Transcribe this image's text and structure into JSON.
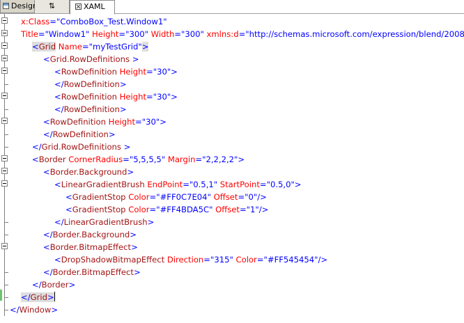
{
  "tabs": {
    "design": "Design",
    "swap": "⇅",
    "xaml": "XAML"
  },
  "lines": [
    {
      "indent": 30,
      "tokens": [
        {
          "t": "x:Class",
          "c": "a"
        },
        {
          "t": "=\"",
          "c": "b"
        },
        {
          "t": "ComboBox_Test.Window1",
          "c": "v"
        },
        {
          "t": "\"",
          "c": "b"
        }
      ]
    },
    {
      "indent": 30,
      "tokens": [
        {
          "t": "Title",
          "c": "a"
        },
        {
          "t": "=\"",
          "c": "b"
        },
        {
          "t": "Window1",
          "c": "v"
        },
        {
          "t": "\" ",
          "c": "b"
        },
        {
          "t": "Height",
          "c": "a"
        },
        {
          "t": "=\"",
          "c": "b"
        },
        {
          "t": "300",
          "c": "v"
        },
        {
          "t": "\" ",
          "c": "b"
        },
        {
          "t": "Width",
          "c": "a"
        },
        {
          "t": "=\"",
          "c": "b"
        },
        {
          "t": "300",
          "c": "v"
        },
        {
          "t": "\" ",
          "c": "b"
        },
        {
          "t": "xmlns:d",
          "c": "a"
        },
        {
          "t": "=\"",
          "c": "b"
        },
        {
          "t": "http://schemas.microsoft.com/expression/blend/2008",
          "c": "v"
        },
        {
          "t": "\"",
          "c": "b"
        }
      ]
    },
    {
      "indent": 46,
      "tokens": [
        {
          "t": "<",
          "c": "b",
          "hl": true
        },
        {
          "t": "Grid",
          "c": "e",
          "hl": true
        },
        {
          "t": " ",
          "c": "b"
        },
        {
          "t": "Name",
          "c": "a"
        },
        {
          "t": "=\"",
          "c": "b"
        },
        {
          "t": "myTestGrid",
          "c": "v"
        },
        {
          "t": "\"",
          "c": "b"
        },
        {
          "t": ">",
          "c": "b",
          "hl": true
        }
      ]
    },
    {
      "indent": 62,
      "tokens": [
        {
          "t": "<",
          "c": "b"
        },
        {
          "t": "Grid.RowDefinitions",
          "c": "e"
        },
        {
          "t": " >",
          "c": "b"
        }
      ]
    },
    {
      "indent": 78,
      "tokens": [
        {
          "t": "<",
          "c": "b"
        },
        {
          "t": "RowDefinition",
          "c": "e"
        },
        {
          "t": " ",
          "c": "b"
        },
        {
          "t": "Height",
          "c": "a"
        },
        {
          "t": "=\"",
          "c": "b"
        },
        {
          "t": "30",
          "c": "v"
        },
        {
          "t": "\">",
          "c": "b"
        }
      ]
    },
    {
      "indent": 78,
      "tokens": [
        {
          "t": "</",
          "c": "b"
        },
        {
          "t": "RowDefinition",
          "c": "e"
        },
        {
          "t": ">",
          "c": "b"
        }
      ]
    },
    {
      "indent": 78,
      "tokens": [
        {
          "t": "<",
          "c": "b"
        },
        {
          "t": "RowDefinition",
          "c": "e"
        },
        {
          "t": " ",
          "c": "b"
        },
        {
          "t": "Height",
          "c": "a"
        },
        {
          "t": "=\"",
          "c": "b"
        },
        {
          "t": "30",
          "c": "v"
        },
        {
          "t": "\">",
          "c": "b"
        }
      ]
    },
    {
      "indent": 78,
      "tokens": [
        {
          "t": "</",
          "c": "b"
        },
        {
          "t": "RowDefinition",
          "c": "e"
        },
        {
          "t": ">",
          "c": "b"
        }
      ]
    },
    {
      "indent": 62,
      "tokens": [
        {
          "t": "<",
          "c": "b"
        },
        {
          "t": "RowDefinition",
          "c": "e"
        },
        {
          "t": " ",
          "c": "b"
        },
        {
          "t": "Height",
          "c": "a"
        },
        {
          "t": "=\"",
          "c": "b"
        },
        {
          "t": "30",
          "c": "v"
        },
        {
          "t": "\">",
          "c": "b"
        }
      ]
    },
    {
      "indent": 62,
      "tokens": [
        {
          "t": "</",
          "c": "b"
        },
        {
          "t": "RowDefinition",
          "c": "e"
        },
        {
          "t": ">",
          "c": "b"
        }
      ]
    },
    {
      "indent": 46,
      "tokens": [
        {
          "t": "</",
          "c": "b"
        },
        {
          "t": "Grid.RowDefinitions",
          "c": "e"
        },
        {
          "t": " >",
          "c": "b"
        }
      ]
    },
    {
      "indent": 46,
      "tokens": [
        {
          "t": "<",
          "c": "b"
        },
        {
          "t": "Border",
          "c": "e"
        },
        {
          "t": " ",
          "c": "b"
        },
        {
          "t": "CornerRadius",
          "c": "a"
        },
        {
          "t": "=\"",
          "c": "b"
        },
        {
          "t": "5,5,5,5",
          "c": "v"
        },
        {
          "t": "\" ",
          "c": "b"
        },
        {
          "t": "Margin",
          "c": "a"
        },
        {
          "t": "=\"",
          "c": "b"
        },
        {
          "t": "2,2,2,2",
          "c": "v"
        },
        {
          "t": "\">",
          "c": "b"
        }
      ]
    },
    {
      "indent": 62,
      "tokens": [
        {
          "t": "<",
          "c": "b"
        },
        {
          "t": "Border.Background",
          "c": "e"
        },
        {
          "t": ">",
          "c": "b"
        }
      ]
    },
    {
      "indent": 78,
      "tokens": [
        {
          "t": "<",
          "c": "b"
        },
        {
          "t": "LinearGradientBrush",
          "c": "e"
        },
        {
          "t": " ",
          "c": "b"
        },
        {
          "t": "EndPoint",
          "c": "a"
        },
        {
          "t": "=\"",
          "c": "b"
        },
        {
          "t": "0.5,1",
          "c": "v"
        },
        {
          "t": "\" ",
          "c": "b"
        },
        {
          "t": "StartPoint",
          "c": "a"
        },
        {
          "t": "=\"",
          "c": "b"
        },
        {
          "t": "0.5,0",
          "c": "v"
        },
        {
          "t": "\">",
          "c": "b"
        }
      ]
    },
    {
      "indent": 94,
      "tokens": [
        {
          "t": "<",
          "c": "b"
        },
        {
          "t": "GradientStop",
          "c": "e"
        },
        {
          "t": " ",
          "c": "b"
        },
        {
          "t": "Color",
          "c": "a"
        },
        {
          "t": "=\"",
          "c": "b"
        },
        {
          "t": "#FF0C7E04",
          "c": "v"
        },
        {
          "t": "\" ",
          "c": "b"
        },
        {
          "t": "Offset",
          "c": "a"
        },
        {
          "t": "=\"",
          "c": "b"
        },
        {
          "t": "0",
          "c": "v"
        },
        {
          "t": "\"/>",
          "c": "b"
        }
      ]
    },
    {
      "indent": 94,
      "tokens": [
        {
          "t": "<",
          "c": "b"
        },
        {
          "t": "GradientStop",
          "c": "e"
        },
        {
          "t": " ",
          "c": "b"
        },
        {
          "t": "Color",
          "c": "a"
        },
        {
          "t": "=\"",
          "c": "b"
        },
        {
          "t": "#FF4BDA5C",
          "c": "v"
        },
        {
          "t": "\" ",
          "c": "b"
        },
        {
          "t": "Offset",
          "c": "a"
        },
        {
          "t": "=\"",
          "c": "b"
        },
        {
          "t": "1",
          "c": "v"
        },
        {
          "t": "\"/>",
          "c": "b"
        }
      ]
    },
    {
      "indent": 78,
      "tokens": [
        {
          "t": "</",
          "c": "b"
        },
        {
          "t": "LinearGradientBrush",
          "c": "e"
        },
        {
          "t": ">",
          "c": "b"
        }
      ]
    },
    {
      "indent": 62,
      "tokens": [
        {
          "t": "</",
          "c": "b"
        },
        {
          "t": "Border.Background",
          "c": "e"
        },
        {
          "t": ">",
          "c": "b"
        }
      ]
    },
    {
      "indent": 62,
      "tokens": [
        {
          "t": "<",
          "c": "b"
        },
        {
          "t": "Border.BitmapEffect",
          "c": "e"
        },
        {
          "t": ">",
          "c": "b"
        }
      ]
    },
    {
      "indent": 78,
      "tokens": [
        {
          "t": "<",
          "c": "b"
        },
        {
          "t": "DropShadowBitmapEffect",
          "c": "e"
        },
        {
          "t": " ",
          "c": "b"
        },
        {
          "t": "Direction",
          "c": "a"
        },
        {
          "t": "=\"",
          "c": "b"
        },
        {
          "t": "315",
          "c": "v"
        },
        {
          "t": "\" ",
          "c": "b"
        },
        {
          "t": "Color",
          "c": "a"
        },
        {
          "t": "=\"",
          "c": "b"
        },
        {
          "t": "#FF545454",
          "c": "v"
        },
        {
          "t": "\"/>",
          "c": "b"
        }
      ]
    },
    {
      "indent": 62,
      "tokens": [
        {
          "t": "</",
          "c": "b"
        },
        {
          "t": "Border.BitmapEffect",
          "c": "e"
        },
        {
          "t": ">",
          "c": "b"
        }
      ]
    },
    {
      "indent": 46,
      "tokens": [
        {
          "t": "</",
          "c": "b"
        },
        {
          "t": "Border",
          "c": "e"
        },
        {
          "t": ">",
          "c": "b"
        }
      ]
    },
    {
      "indent": 30,
      "tokens": [
        {
          "t": "</",
          "c": "b",
          "hl": true
        },
        {
          "t": "Grid",
          "c": "e",
          "hl": true
        },
        {
          "t": ">",
          "c": "b",
          "hl": true
        }
      ],
      "caret": true
    },
    {
      "indent": 14,
      "tokens": [
        {
          "t": "</",
          "c": "b"
        },
        {
          "t": "Window",
          "c": "e"
        },
        {
          "t": ">",
          "c": "b"
        }
      ]
    }
  ]
}
